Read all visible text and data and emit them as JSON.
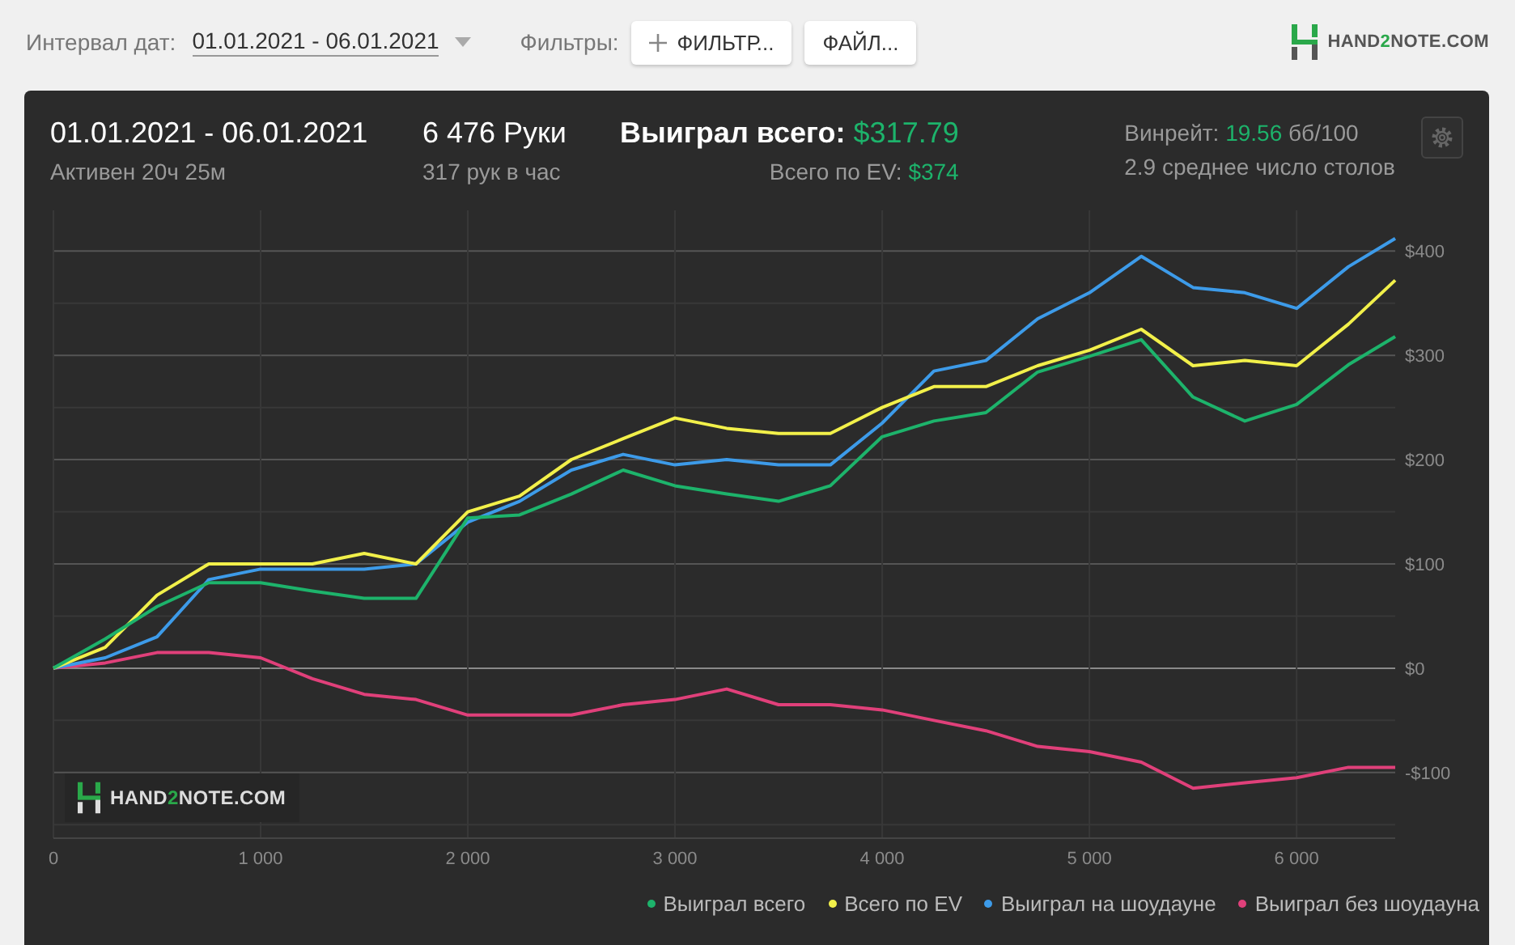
{
  "toolbar": {
    "date_label": "Интервал дат:",
    "date_range": "01.01.2021 - 06.01.2021",
    "filters_label": "Фильтры:",
    "buttons": [
      {
        "kind": "add",
        "label": "ФИЛЬТР..."
      },
      {
        "kind": "plain",
        "label": "ФАЙЛ..."
      }
    ],
    "logo": {
      "before": "HAND",
      "accent": "2",
      "after": "NOTE.COM"
    }
  },
  "summary": {
    "period": "01.01.2021 - 06.01.2021",
    "active": "Активен 20ч 25м",
    "hands": "6 476 Руки",
    "hands_rate": "317 рук в час",
    "won_label": "Выиграл всего:",
    "won_value": "$317.79",
    "ev_label": "Всего по EV:",
    "ev_value": "$374",
    "winrate_label": "Винрейт:",
    "winrate_value": "19.56",
    "winrate_unit": "бб/100",
    "tables": "2.9 среднее число столов"
  },
  "chart": {
    "watermark": {
      "before": "HAND",
      "accent": "2",
      "after": "NOTE.COM"
    },
    "chart_data": {
      "type": "line",
      "grid": true,
      "x": [
        0,
        250,
        500,
        750,
        1000,
        1250,
        1500,
        1750,
        2000,
        2250,
        2500,
        2750,
        3000,
        3250,
        3500,
        3750,
        4000,
        4250,
        4500,
        4750,
        5000,
        5250,
        5500,
        5750,
        6000,
        6250,
        6476
      ],
      "xlim": [
        0,
        6476
      ],
      "ylim": [
        -163,
        439
      ],
      "xticks": [
        {
          "value": 0,
          "label": "0"
        },
        {
          "value": 1000,
          "label": "1 000"
        },
        {
          "value": 2000,
          "label": "2 000"
        },
        {
          "value": 3000,
          "label": "3 000"
        },
        {
          "value": 4000,
          "label": "4 000"
        },
        {
          "value": 5000,
          "label": "5 000"
        },
        {
          "value": 6000,
          "label": "6 000"
        }
      ],
      "yticks": [
        {
          "value": -100,
          "label": "-$100"
        },
        {
          "value": 0,
          "label": "$0"
        },
        {
          "value": 100,
          "label": "$100"
        },
        {
          "value": 200,
          "label": "$200"
        },
        {
          "value": 300,
          "label": "$300"
        },
        {
          "value": 400,
          "label": "$400"
        }
      ],
      "series": [
        {
          "name": "Выиграл всего",
          "color": "#1db36b",
          "values": [
            0,
            28,
            59,
            82,
            82,
            74,
            67,
            67,
            144,
            147,
            167,
            190,
            175,
            167,
            160,
            175,
            222,
            237,
            245,
            284,
            299,
            315,
            260,
            237,
            253,
            291,
            318
          ]
        },
        {
          "name": "Всего по EV",
          "color": "#f2f04a",
          "values": [
            0,
            20,
            70,
            100,
            100,
            100,
            110,
            100,
            150,
            165,
            200,
            220,
            240,
            230,
            225,
            225,
            250,
            270,
            270,
            290,
            305,
            325,
            290,
            295,
            290,
            330,
            372
          ]
        },
        {
          "name": "Выиграл на шоудауне",
          "color": "#3d9be9",
          "values": [
            0,
            10,
            30,
            85,
            95,
            95,
            95,
            100,
            140,
            160,
            190,
            205,
            195,
            200,
            195,
            195,
            235,
            285,
            295,
            335,
            360,
            395,
            365,
            360,
            345,
            385,
            412
          ]
        },
        {
          "name": "Выиграл без шоудауна",
          "color": "#e0407a",
          "values": [
            0,
            5,
            15,
            15,
            10,
            -10,
            -25,
            -30,
            -45,
            -45,
            -45,
            -35,
            -30,
            -20,
            -35,
            -35,
            -40,
            -50,
            -60,
            -75,
            -80,
            -90,
            -115,
            -110,
            -105,
            -95,
            -95
          ]
        }
      ]
    }
  }
}
